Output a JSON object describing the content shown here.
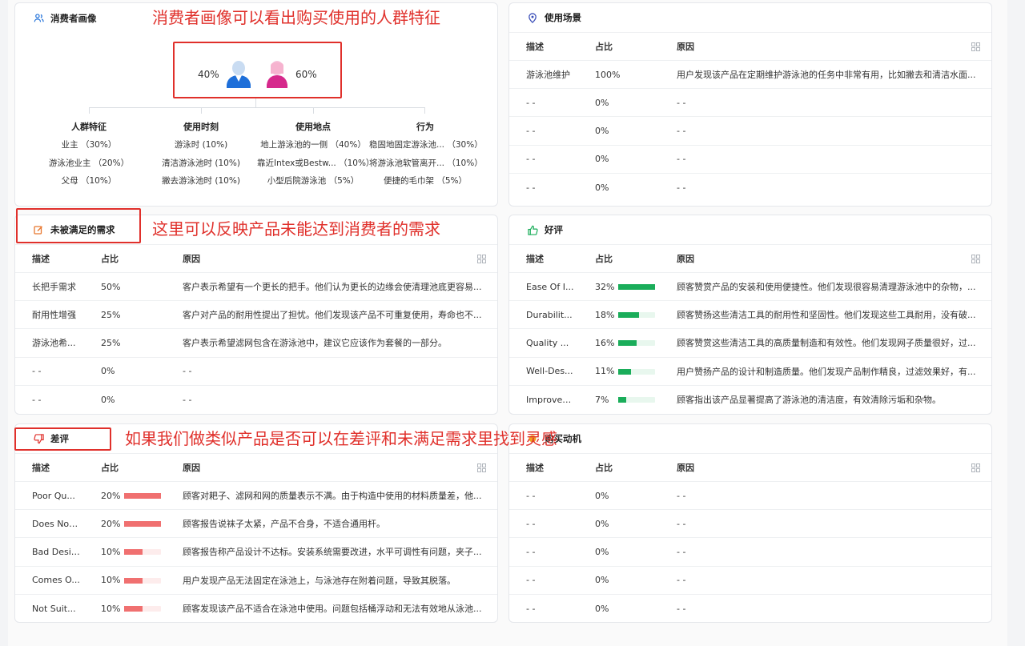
{
  "persona": {
    "title": "消费者画像",
    "male_pct": "40%",
    "female_pct": "60%",
    "columns": [
      {
        "header": "人群特征",
        "items": [
          "业主 （30%）",
          "游泳池业主 （20%）",
          "父母 （10%）"
        ]
      },
      {
        "header": "使用时刻",
        "items": [
          "游泳时 (10%)",
          "清洁游泳池时 (10%)",
          "撇去游泳池时 (10%)"
        ]
      },
      {
        "header": "使用地点",
        "items": [
          "地上游泳池的一侧 （40%）",
          "靠近Intex或Bestw... （10%）",
          "小型后院游泳池 （5%）"
        ]
      },
      {
        "header": "行为",
        "items": [
          "稳固地固定游泳池... （30%）",
          "将游泳池软管离开... （10%）",
          "便捷的毛巾架 （5%）"
        ]
      }
    ]
  },
  "usage": {
    "title": "使用场景",
    "headers": {
      "desc": "描述",
      "pct": "占比",
      "reason": "原因"
    },
    "rows": [
      {
        "desc": "游泳池维护",
        "pct": "100%",
        "reason": "用户发现该产品在定期维护游泳池的任务中非常有用，比如撇去和清洁水面..."
      },
      {
        "desc": "- -",
        "pct": "0%",
        "reason": "- -"
      },
      {
        "desc": "- -",
        "pct": "0%",
        "reason": "- -"
      },
      {
        "desc": "- -",
        "pct": "0%",
        "reason": "- -"
      },
      {
        "desc": "- -",
        "pct": "0%",
        "reason": "- -"
      }
    ]
  },
  "unmet": {
    "title": "未被满足的需求",
    "headers": {
      "desc": "描述",
      "pct": "占比",
      "reason": "原因"
    },
    "rows": [
      {
        "desc": "长把手需求",
        "pct": "50%",
        "reason": "客户表示希望有一个更长的把手。他们认为更长的边缘会使清理池底更容易..."
      },
      {
        "desc": "耐用性增强",
        "pct": "25%",
        "reason": "客户对产品的耐用性提出了担忧。他们发现该产品不可重复使用，寿命也不..."
      },
      {
        "desc": "游泳池希...",
        "pct": "25%",
        "reason": "客户表示希望滤网包含在游泳池中，建议它应该作为套餐的一部分。"
      },
      {
        "desc": "- -",
        "pct": "0%",
        "reason": "- -"
      },
      {
        "desc": "- -",
        "pct": "0%",
        "reason": "- -"
      }
    ]
  },
  "positive": {
    "title": "好评",
    "headers": {
      "desc": "描述",
      "pct": "占比",
      "reason": "原因"
    },
    "bar_color": "#1aad5a",
    "bar_bg": "#e8f7ee",
    "rows": [
      {
        "desc": "Ease Of I...",
        "pct": "32%",
        "fraction": 1.0,
        "reason": "顾客赞赏产品的安装和使用便捷性。他们发现很容易清理游泳池中的杂物，..."
      },
      {
        "desc": "Durabilit...",
        "pct": "18%",
        "fraction": 0.56,
        "reason": "顾客赞扬这些清洁工具的耐用性和坚固性。他们发现这些工具耐用，没有破..."
      },
      {
        "desc": "Quality ...",
        "pct": "16%",
        "fraction": 0.5,
        "reason": "顾客赞赏这些清洁工具的高质量制造和有效性。他们发现网子质量很好，过..."
      },
      {
        "desc": "Well-Des...",
        "pct": "11%",
        "fraction": 0.34,
        "reason": "用户赞扬产品的设计和制造质量。他们发现产品制作精良，过滤效果好，有..."
      },
      {
        "desc": "Improves...",
        "pct": "7%",
        "fraction": 0.22,
        "reason": "顾客指出该产品显著提高了游泳池的清洁度，有效清除污垢和杂物。"
      }
    ]
  },
  "negative": {
    "title": "差评",
    "headers": {
      "desc": "描述",
      "pct": "占比",
      "reason": "原因"
    },
    "bar_color": "#f07070",
    "bar_bg": "#fdecec",
    "rows": [
      {
        "desc": "Poor Qu...",
        "pct": "20%",
        "fraction": 1.0,
        "reason": "顾客对耙子、滤网和网的质量表示不满。由于构造中使用的材料质量差，他..."
      },
      {
        "desc": "Does Not...",
        "pct": "20%",
        "fraction": 1.0,
        "reason": "顾客报告说袜子太紧，产品不合身，不适合通用杆。"
      },
      {
        "desc": "Bad Design",
        "pct": "10%",
        "fraction": 0.5,
        "reason": "顾客报告称产品设计不达标。安装系统需要改进，水平可调性有问题，夹子..."
      },
      {
        "desc": "Comes O...",
        "pct": "10%",
        "fraction": 0.5,
        "reason": "用户发现产品无法固定在泳池上，与泳池存在附着问题，导致其脱落。"
      },
      {
        "desc": "Not Suit...",
        "pct": "10%",
        "fraction": 0.5,
        "reason": "顾客发现该产品不适合在泳池中使用。问题包括桶浮动和无法有效地从泳池..."
      }
    ]
  },
  "motive": {
    "title": "购买动机",
    "headers": {
      "desc": "描述",
      "pct": "占比",
      "reason": "原因"
    },
    "rows": [
      {
        "desc": "- -",
        "pct": "0%",
        "reason": "- -"
      },
      {
        "desc": "- -",
        "pct": "0%",
        "reason": "- -"
      },
      {
        "desc": "- -",
        "pct": "0%",
        "reason": "- -"
      },
      {
        "desc": "- -",
        "pct": "0%",
        "reason": "- -"
      },
      {
        "desc": "- -",
        "pct": "0%",
        "reason": "- -"
      }
    ]
  },
  "annotations": {
    "a1": "消费者画像可以看出购买使用的人群特征",
    "a2": "这里可以反映产品未能达到消费者的需求",
    "a3": "如果我们做类似产品是否可以在差评和未满足需求里找到灵感"
  },
  "colors": {
    "accent_red": "#e0302b",
    "male": "#1e6fd9",
    "female": "#d6298c"
  }
}
